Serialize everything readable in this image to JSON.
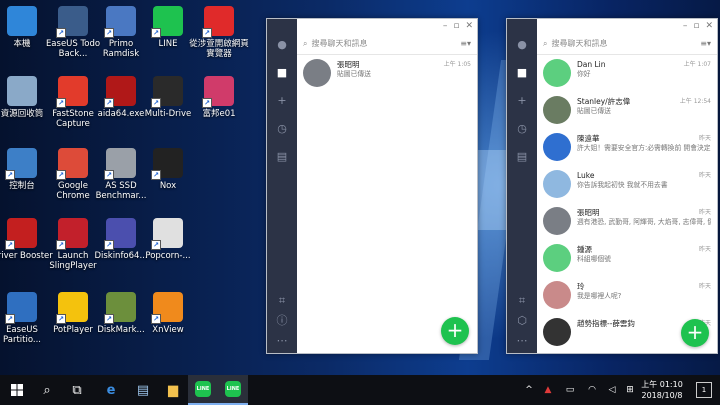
{
  "desktop": {
    "icons": [
      {
        "label": "本機",
        "icon": "computer-icon",
        "color": "#2f86d9"
      },
      {
        "label": "EaseUS Todo Back...",
        "icon": "easeus-backup-icon",
        "color": "#3a5c8a"
      },
      {
        "label": "Primo Ramdisk",
        "icon": "primo-ramdisk-icon",
        "color": "#4a78c2"
      },
      {
        "label": "LINE",
        "icon": "line-icon",
        "color": "#1ec24f"
      },
      {
        "label": "從涉萱開啟網頁實覽器",
        "icon": "pizza-icon",
        "color": "#e02a2a"
      },
      {
        "label": "資源回收筒",
        "icon": "recycle-bin-icon",
        "color": "#8aa9c8"
      },
      {
        "label": "FastStone Capture",
        "icon": "faststone-icon",
        "color": "#e23b2b"
      },
      {
        "label": "aida64.exe",
        "icon": "aida64-icon",
        "color": "#b01818"
      },
      {
        "label": "Multi-Drive",
        "icon": "nox-multidrive-icon",
        "color": "#2a2a2a"
      },
      {
        "label": "富邦e01",
        "icon": "fubon-icon",
        "color": "#d03b6a"
      },
      {
        "label": "控制台",
        "icon": "control-panel-icon",
        "color": "#3d7fc7"
      },
      {
        "label": "Google Chrome",
        "icon": "chrome-icon",
        "color": "#dd4b39"
      },
      {
        "label": "AS SSD Benchmar...",
        "icon": "as-ssd-icon",
        "color": "#9aa0a8"
      },
      {
        "label": "Nox",
        "icon": "nox-icon",
        "color": "#222"
      },
      {
        "label": "Driver Booster",
        "icon": "driver-booster-icon",
        "color": "#c31f1f"
      },
      {
        "label": "Launch SlingPlayer",
        "icon": "slingplayer-icon",
        "color": "#c2202b"
      },
      {
        "label": "Diskinfo64...",
        "icon": "diskinfo-icon",
        "color": "#4b4fae"
      },
      {
        "label": "Popcorn-...",
        "icon": "popcorn-icon",
        "color": "#e0e0e0"
      },
      {
        "label": "EaseUS Partitio...",
        "icon": "easeus-partition-icon",
        "color": "#2f6fc0"
      },
      {
        "label": "PotPlayer",
        "icon": "potplayer-icon",
        "color": "#f4c20d"
      },
      {
        "label": "DiskMark...",
        "icon": "diskmark-icon",
        "color": "#6c8f3c"
      },
      {
        "label": "XnView",
        "icon": "xnview-icon",
        "color": "#f08a1c"
      }
    ]
  },
  "window_left": {
    "search_placeholder": "搜尋聊天和訊息",
    "chats": [
      {
        "name": "張昭明",
        "message": "貼圖已傳送",
        "time": "上午 1:05",
        "avatar_color": "#7a7e85"
      }
    ]
  },
  "window_right": {
    "search_placeholder": "搜尋聊天和訊息",
    "chats": [
      {
        "name": "Dan Lin",
        "message": "你好",
        "time": "上午 1:07",
        "avatar_color": "#5ccf7f"
      },
      {
        "name": "Stanley/許志偉",
        "message": "貼圖已傳送",
        "time": "上午 12:54",
        "avatar_color": "#6a7c62"
      },
      {
        "name": "陳遠華",
        "message": "許大姐！需要安全官方:必需轉換前 開會決定逐等 https://iwappledaily...",
        "time": "昨天",
        "avatar_color": "#2f6fd0"
      },
      {
        "name": "Luke",
        "message": "你告訴我起初快 我就不用去書",
        "time": "昨天",
        "avatar_color": "#8fb8e0"
      },
      {
        "name": "張昭明",
        "message": "週有港恐, 武勤哥, 阿輝哥, 大焰哥, 志偉哥, 健銘哥, 阿富哥, 業鈞哥等",
        "time": "昨天",
        "avatar_color": "#7a7e85"
      },
      {
        "name": "鍾源",
        "message": "科組哪個號",
        "time": "昨天",
        "avatar_color": "#5ccf7f"
      },
      {
        "name": "玲",
        "message": "我是哪裡人呢?",
        "time": "昨天",
        "avatar_color": "#c98a8a"
      },
      {
        "name": "趙勢指標--薛雲鈞",
        "message": "",
        "time": "昨天",
        "avatar_color": "#333"
      }
    ]
  },
  "fab_label": "+",
  "taskbar": {
    "clock_time": "上午 01:10",
    "clock_date": "2018/10/8",
    "notification_count": "1"
  }
}
